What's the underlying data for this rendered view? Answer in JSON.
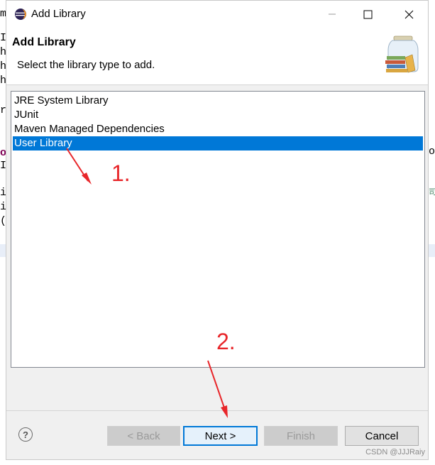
{
  "background_editor": {
    "left_glyphs": [
      "m",
      "I",
      "h",
      "h",
      "h",
      "r",
      "o",
      "I",
      "i",
      "i",
      "("
    ],
    "right_glyphs": [
      "o",
      "司"
    ]
  },
  "window": {
    "title": "Add Library",
    "minimize_icon": "minimize-icon",
    "maximize_icon": "maximize-icon",
    "close_icon": "close-icon"
  },
  "header": {
    "title": "Add Library",
    "message": "Select the library type to add."
  },
  "library_types": {
    "items": [
      "JRE System Library",
      "JUnit",
      "Maven Managed Dependencies",
      "User Library"
    ],
    "selected": "User Library"
  },
  "buttons": {
    "help": "?",
    "back": "< Back",
    "next": "Next >",
    "finish": "Finish",
    "cancel": "Cancel"
  },
  "annotations": {
    "step1": "1.",
    "step2": "2.",
    "color": "#e8262a"
  },
  "watermark": "CSDN @JJJRaiy",
  "colors": {
    "selection": "#0078d7",
    "default_button_border": "#0078d7"
  }
}
